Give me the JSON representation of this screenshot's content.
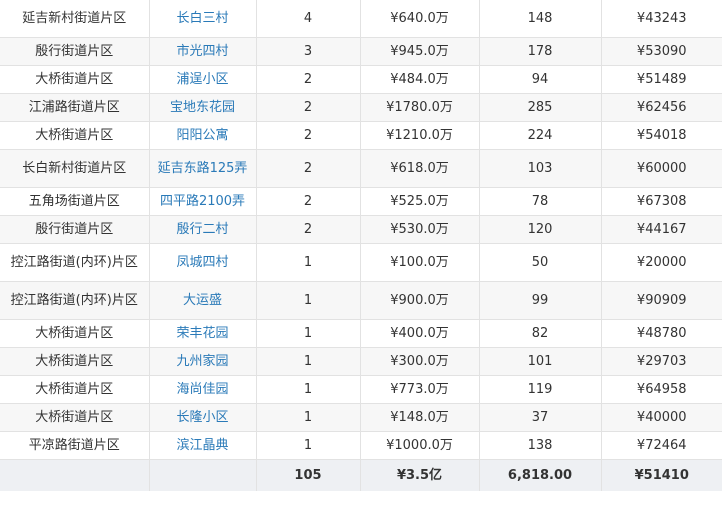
{
  "rows": [
    {
      "district": "延吉新村街道片区",
      "community": "长白三村",
      "count": "4",
      "total": "¥640.0万",
      "area": "148",
      "unit_price": "¥43243"
    },
    {
      "district": "殷行街道片区",
      "community": "市光四村",
      "count": "3",
      "total": "¥945.0万",
      "area": "178",
      "unit_price": "¥53090"
    },
    {
      "district": "大桥街道片区",
      "community": "浦逞小区",
      "count": "2",
      "total": "¥484.0万",
      "area": "94",
      "unit_price": "¥51489"
    },
    {
      "district": "江浦路街道片区",
      "community": "宝地东花园",
      "count": "2",
      "total": "¥1780.0万",
      "area": "285",
      "unit_price": "¥62456"
    },
    {
      "district": "大桥街道片区",
      "community": "阳阳公寓",
      "count": "2",
      "total": "¥1210.0万",
      "area": "224",
      "unit_price": "¥54018"
    },
    {
      "district": "长白新村街道片区",
      "community": "延吉东路125弄",
      "count": "2",
      "total": "¥618.0万",
      "area": "103",
      "unit_price": "¥60000"
    },
    {
      "district": "五角场街道片区",
      "community": "四平路2100弄",
      "count": "2",
      "total": "¥525.0万",
      "area": "78",
      "unit_price": "¥67308"
    },
    {
      "district": "殷行街道片区",
      "community": "殷行二村",
      "count": "2",
      "total": "¥530.0万",
      "area": "120",
      "unit_price": "¥44167"
    },
    {
      "district": "控江路街道(内环)片区",
      "community": "凤城四村",
      "count": "1",
      "total": "¥100.0万",
      "area": "50",
      "unit_price": "¥20000"
    },
    {
      "district": "控江路街道(内环)片区",
      "community": "大运盛",
      "count": "1",
      "total": "¥900.0万",
      "area": "99",
      "unit_price": "¥90909"
    },
    {
      "district": "大桥街道片区",
      "community": "荣丰花园",
      "count": "1",
      "total": "¥400.0万",
      "area": "82",
      "unit_price": "¥48780"
    },
    {
      "district": "大桥街道片区",
      "community": "九州家园",
      "count": "1",
      "total": "¥300.0万",
      "area": "101",
      "unit_price": "¥29703"
    },
    {
      "district": "大桥街道片区",
      "community": "海尚佳园",
      "count": "1",
      "total": "¥773.0万",
      "area": "119",
      "unit_price": "¥64958"
    },
    {
      "district": "大桥街道片区",
      "community": "长隆小区",
      "count": "1",
      "total": "¥148.0万",
      "area": "37",
      "unit_price": "¥40000"
    },
    {
      "district": "平凉路街道片区",
      "community": "滨江晶典",
      "count": "1",
      "total": "¥1000.0万",
      "area": "138",
      "unit_price": "¥72464"
    }
  ],
  "totals": {
    "label": "",
    "community": "",
    "count": "105",
    "total": "¥3.5亿",
    "area": "6,818.00",
    "unit_price": "¥51410"
  }
}
